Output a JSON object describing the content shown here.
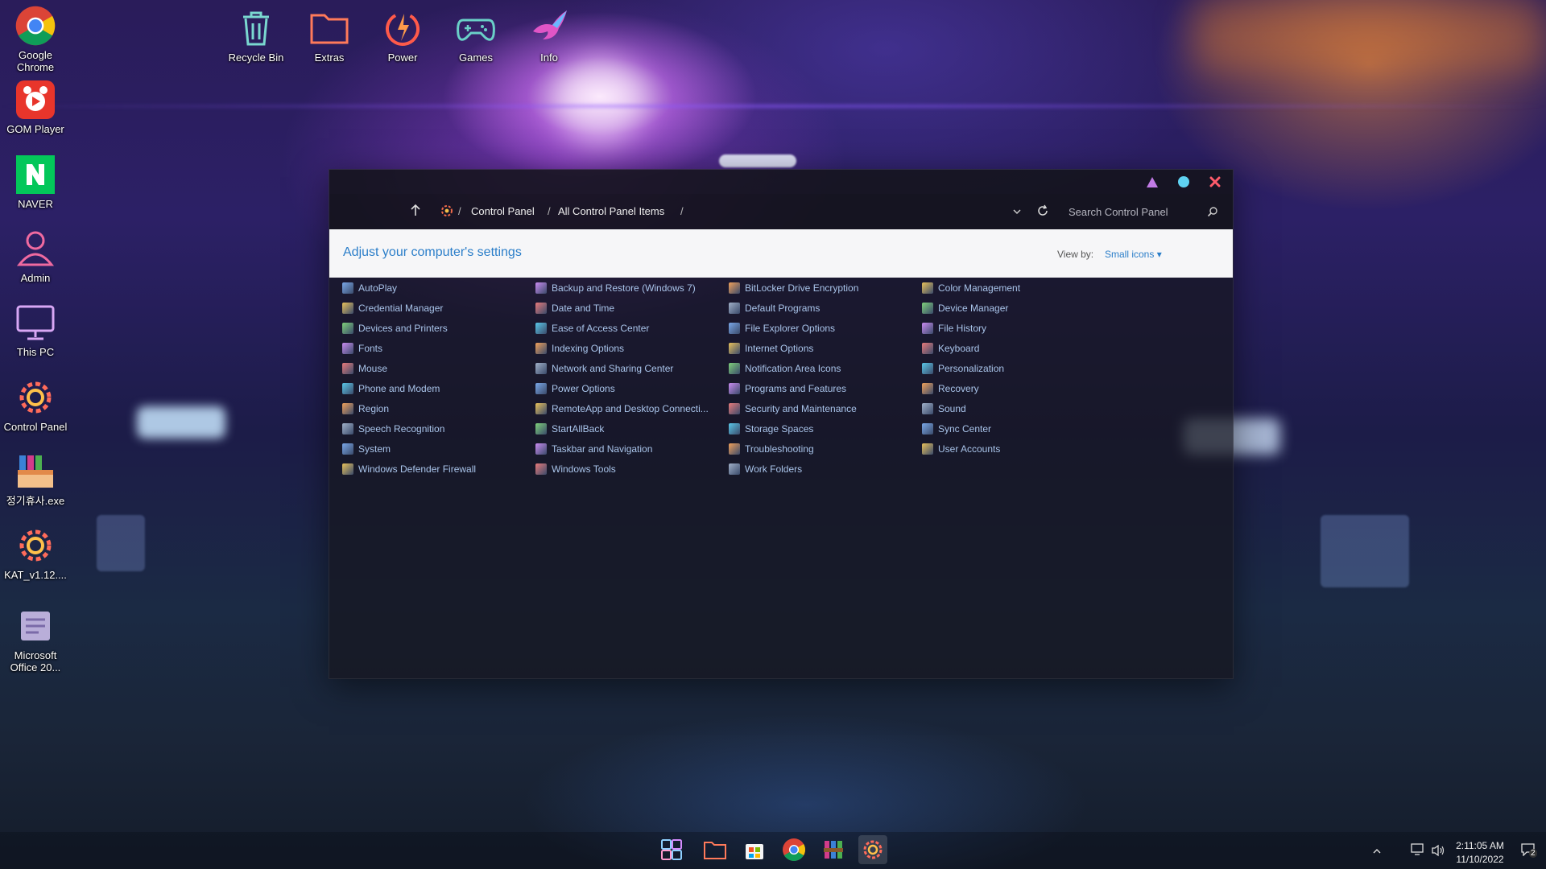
{
  "desktop_left": [
    {
      "label": "Google Chrome",
      "icon": "chrome-icon"
    },
    {
      "label": "GOM Player",
      "icon": "gom-player-icon"
    },
    {
      "label": "NAVER",
      "icon": "naver-icon"
    },
    {
      "label": "Admin",
      "icon": "user-icon"
    },
    {
      "label": "This PC",
      "icon": "monitor-icon"
    },
    {
      "label": "Control Panel",
      "icon": "gear-icon"
    },
    {
      "label": "정기휴사.exe",
      "icon": "archive-icon"
    },
    {
      "label": "KAT_v1.12....",
      "icon": "gear-icon"
    },
    {
      "label": "Microsoft Office 20...",
      "icon": "office-icon"
    }
  ],
  "desktop_top": [
    {
      "label": "Recycle Bin",
      "icon": "recycle-bin-icon"
    },
    {
      "label": "Extras",
      "icon": "folder-icon"
    },
    {
      "label": "Power",
      "icon": "power-icon"
    },
    {
      "label": "Games",
      "icon": "gamepad-icon"
    },
    {
      "label": "Info",
      "icon": "bird-icon"
    }
  ],
  "window": {
    "breadcrumb": [
      "Control Panel",
      "All Control Panel Items"
    ],
    "breadcrumb_sep": "/",
    "search_placeholder": "Search Control Panel",
    "title": "Adjust your computer's settings",
    "view_by_label": "View by:",
    "view_by_value": "Small icons ▾",
    "columns": [
      [
        "AutoPlay",
        "Credential Manager",
        "Devices and Printers",
        "Fonts",
        "Mouse",
        "Phone and Modem",
        "Region",
        "Speech Recognition",
        "System",
        "Windows Defender Firewall"
      ],
      [
        "Backup and Restore (Windows 7)",
        "Date and Time",
        "Ease of Access Center",
        "Indexing Options",
        "Network and Sharing Center",
        "Power Options",
        "RemoteApp and Desktop Connecti...",
        "StartAllBack",
        "Taskbar and Navigation",
        "Windows Tools"
      ],
      [
        "BitLocker Drive Encryption",
        "Default Programs",
        "File Explorer Options",
        "Internet Options",
        "Notification Area Icons",
        "Programs and Features",
        "Security and Maintenance",
        "Storage Spaces",
        "Troubleshooting",
        "Work Folders"
      ],
      [
        "Color Management",
        "Device Manager",
        "File History",
        "Keyboard",
        "Personalization",
        "Recovery",
        "Sound",
        "Sync Center",
        "User Accounts"
      ]
    ]
  },
  "taskbar": {
    "apps": [
      "start-icon",
      "file-explorer-icon",
      "store-icon",
      "chrome-icon",
      "winrar-icon",
      "control-panel-icon"
    ],
    "time": "2:11:05 AM",
    "date": "11/10/2022",
    "notification_count": "2"
  },
  "colors": {
    "accent": "#2b7ec9",
    "item_text": "#a9c4ea"
  }
}
